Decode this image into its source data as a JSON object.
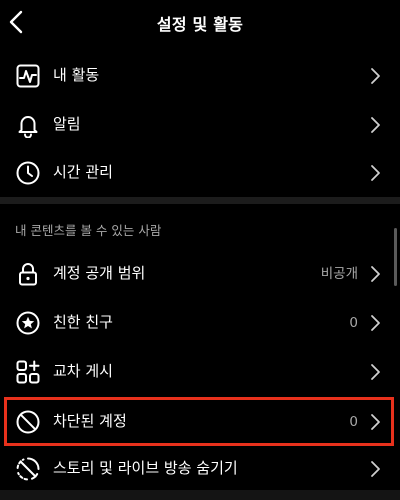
{
  "header": {
    "title": "설정 및 활동"
  },
  "activity_rows": [
    {
      "label": "내 활동",
      "icon": "activity-icon"
    },
    {
      "label": "알림",
      "icon": "bell-icon"
    },
    {
      "label": "시간 관리",
      "icon": "clock-icon"
    }
  ],
  "audience_section": {
    "title": "내 콘텐츠를 볼 수 있는 사람",
    "rows": [
      {
        "label": "계정 공개 범위",
        "value": "비공개",
        "icon": "lock-icon"
      },
      {
        "label": "친한 친구",
        "value": "0",
        "icon": "star-circle-icon"
      },
      {
        "label": "교차 게시",
        "value": "",
        "icon": "grid-plus-icon"
      },
      {
        "label": "차단된 계정",
        "value": "0",
        "icon": "blocked-icon"
      },
      {
        "label": "스토리 및 라이브 방송 숨기기",
        "value": "",
        "icon": "hide-story-icon"
      }
    ]
  },
  "colors": {
    "background": "#000000",
    "text": "#ffffff",
    "secondary_text": "#a8a8a8",
    "divider": "#1c1c1c",
    "highlight": "#e8311c"
  }
}
